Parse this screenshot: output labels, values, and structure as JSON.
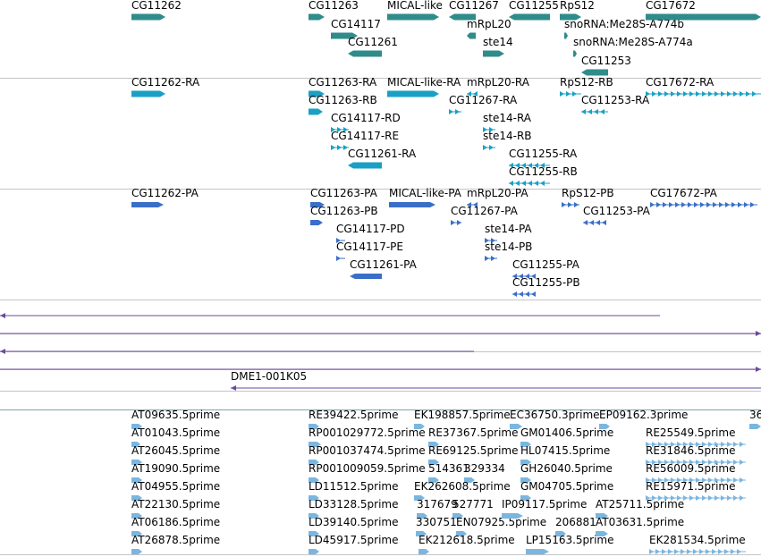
{
  "colors": {
    "gene": "#2f8c8a",
    "transcript": "#1aa0c4",
    "protein": "#3a6fc9",
    "alignment": "#6a4a9c",
    "est": "#7ab6e0",
    "separator": "#c4c4c4",
    "separator_dark": "#7aa6b4"
  },
  "gene_track": [
    {
      "label": "CG11262"
    },
    {
      "label": "CG11263"
    },
    {
      "label": "CG14117"
    },
    {
      "label": "CG11261"
    },
    {
      "label": "MICAL-like"
    },
    {
      "label": "CG11267"
    },
    {
      "label": "mRpL20"
    },
    {
      "label": "ste14"
    },
    {
      "label": "CG11255"
    },
    {
      "label": "RpS12"
    },
    {
      "label": "snoRNA:Me28S-A774b"
    },
    {
      "label": "snoRNA:Me28S-A774a"
    },
    {
      "label": "CG11253"
    },
    {
      "label": "CG17672"
    }
  ],
  "transcript_track": [
    {
      "label": "CG11262-RA"
    },
    {
      "label": "CG11263-RA"
    },
    {
      "label": "CG11263-RB"
    },
    {
      "label": "CG14117-RD"
    },
    {
      "label": "CG14117-RE"
    },
    {
      "label": "CG11261-RA"
    },
    {
      "label": "MICAL-like-RA"
    },
    {
      "label": "mRpL20-RA"
    },
    {
      "label": "CG11267-RA"
    },
    {
      "label": "ste14-RA"
    },
    {
      "label": "ste14-RB"
    },
    {
      "label": "CG11255-RA"
    },
    {
      "label": "CG11255-RB"
    },
    {
      "label": "RpS12-RB"
    },
    {
      "label": "CG11253-RA"
    },
    {
      "label": "CG17672-RA"
    }
  ],
  "protein_track": [
    {
      "label": "CG11262-PA"
    },
    {
      "label": "CG11263-PA"
    },
    {
      "label": "CG11263-PB"
    },
    {
      "label": "CG14117-PD"
    },
    {
      "label": "CG14117-PE"
    },
    {
      "label": "CG11261-PA"
    },
    {
      "label": "MICAL-like-PA"
    },
    {
      "label": "mRpL20-PA"
    },
    {
      "label": "CG11267-PA"
    },
    {
      "label": "ste14-PA"
    },
    {
      "label": "ste14-PB"
    },
    {
      "label": "CG11255-PA"
    },
    {
      "label": "CG11255-PB"
    },
    {
      "label": "RpS12-PB"
    },
    {
      "label": "CG11253-PA"
    },
    {
      "label": "CG17672-PA"
    }
  ],
  "alignment_track": [
    {
      "label": ""
    },
    {
      "label": ""
    },
    {
      "label": ""
    },
    {
      "label": ""
    },
    {
      "label": "DME1-001K05"
    }
  ],
  "est_track": [
    {
      "label": "AT09635.5prime"
    },
    {
      "label": "AT01043.5prime"
    },
    {
      "label": "AT26045.5prime"
    },
    {
      "label": "AT19090.5prime"
    },
    {
      "label": "AT04955.5prime"
    },
    {
      "label": "AT22130.5prime"
    },
    {
      "label": "AT06186.5prime"
    },
    {
      "label": "AT26878.5prime"
    },
    {
      "label": "RE39422.5prime"
    },
    {
      "label": "RP001029772.5prime"
    },
    {
      "label": "RP001037474.5prime"
    },
    {
      "label": "RP001009059.5prime"
    },
    {
      "label": "LD11512.5prime"
    },
    {
      "label": "LD33128.5prime"
    },
    {
      "label": "LD39140.5prime"
    },
    {
      "label": "LD45917.5prime"
    },
    {
      "label": "EK198857.5prime"
    },
    {
      "label": "RE37367.5prime"
    },
    {
      "label": "RE69125.5prime"
    },
    {
      "label": "514361"
    },
    {
      "label": "329334"
    },
    {
      "label": "EK262608.5prime"
    },
    {
      "label": "317679"
    },
    {
      "label": "527771"
    },
    {
      "label": "330751"
    },
    {
      "label": "EN07925.5prime"
    },
    {
      "label": "EK212618.5prime"
    },
    {
      "label": "EC36750.3prime"
    },
    {
      "label": "GM01406.5prime"
    },
    {
      "label": "HL07415.5prime"
    },
    {
      "label": "GH26040.5prime"
    },
    {
      "label": "GM04705.5prime"
    },
    {
      "label": "IP09117.5prime"
    },
    {
      "label": "206881"
    },
    {
      "label": "LP15163.5prime"
    },
    {
      "label": "EP09162.3prime"
    },
    {
      "label": "AT25711.5prime"
    },
    {
      "label": "AT03631.5prime"
    },
    {
      "label": "RE25549.5prime"
    },
    {
      "label": "RE31846.5prime"
    },
    {
      "label": "RE56009.5prime"
    },
    {
      "label": "RE15971.5prime"
    },
    {
      "label": "EK281534.5prime"
    },
    {
      "label": "36"
    }
  ]
}
